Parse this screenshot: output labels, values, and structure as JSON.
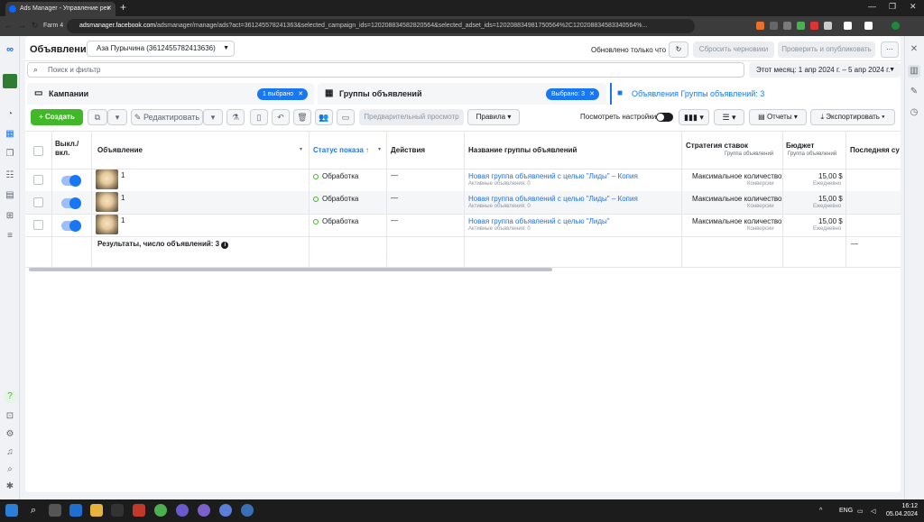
{
  "browser": {
    "tab_title": "Ads Manager - Управление рек",
    "profile": "Farm 4",
    "url_host": "adsmanager.facebook.com",
    "url_rest": "/adsmanager/manage/ads?act=361245578241363&selected_campaign_ids=120208834582820564&selected_adset_ids=120208834981750564%2C120208834583340564%..."
  },
  "header": {
    "title": "Объявления",
    "account": "Аза Пурычина (361245578241363​6)",
    "updated": "Обновлено только что",
    "discard_label": "Сбросить черновики",
    "review_label": "Проверить и опубликовать",
    "more_label": "···"
  },
  "search": {
    "placeholder": "Поиск и фильтр",
    "date_range": "Этот месяц: 1 апр 2024 г. – 5 апр 2024 г."
  },
  "tabs": [
    {
      "label": "Кампании",
      "chip": "1 выбрано"
    },
    {
      "label": "Группы объявлений",
      "chip": "Выбрано: 3"
    },
    {
      "label": "Объявления Группы объявлений: 3"
    }
  ],
  "actions": {
    "create": "+ Создать",
    "edit": "Редактировать",
    "preview": "Предварительный просмотр",
    "rules": "Правила",
    "view_settings": "Посмотреть настройки",
    "reports": "Отчеты",
    "export": "Экспортировать"
  },
  "columns": {
    "onoff": "Выкл./ вкл.",
    "ad": "Объявление",
    "status": "Статус показа ↑",
    "actions": "Действия",
    "adset": "Название группы объявлений",
    "bid": "Стратегия ставок",
    "bid_sub": "Группа объявлений",
    "budget": "Бюджет",
    "budget_sub": "Группа объявлений",
    "last": "Последняя су"
  },
  "rows": [
    {
      "name": "1",
      "status": "Обработка",
      "actions": "—",
      "adset": "Новая группа объявлений с целью \"Лиды\" – Копия",
      "adset_sub": "Активные объявления: 0",
      "bid": "Максимальное количество",
      "bid_sub": "Конверсии",
      "budget": "15,00 $",
      "budget_sub": "Ежедневно"
    },
    {
      "name": "1",
      "status": "Обработка",
      "actions": "—",
      "adset": "Новая группа объявлений с целью \"Лиды\" – Копия",
      "adset_sub": "Активные объявления: 0",
      "bid": "Максимальное количество",
      "bid_sub": "Конверсии",
      "budget": "15,00 $",
      "budget_sub": "Ежедневно"
    },
    {
      "name": "1",
      "status": "Обработка",
      "actions": "—",
      "adset": "Новая группа объявлений с целью \"Лиды\"",
      "adset_sub": "Активные объявления: 0",
      "bid": "Максимальное количество",
      "bid_sub": "Конверсии",
      "budget": "15,00 $",
      "budget_sub": "Ежедневно"
    }
  ],
  "footer": {
    "results": "Результаты, число объявлений: 3",
    "last": "—"
  },
  "taskbar": {
    "lang": "ENG",
    "time": "16:12",
    "date": "05.04.2024"
  },
  "colors": {
    "accent": "#1877f2",
    "create": "#42b72a",
    "link": "#216fdb"
  }
}
